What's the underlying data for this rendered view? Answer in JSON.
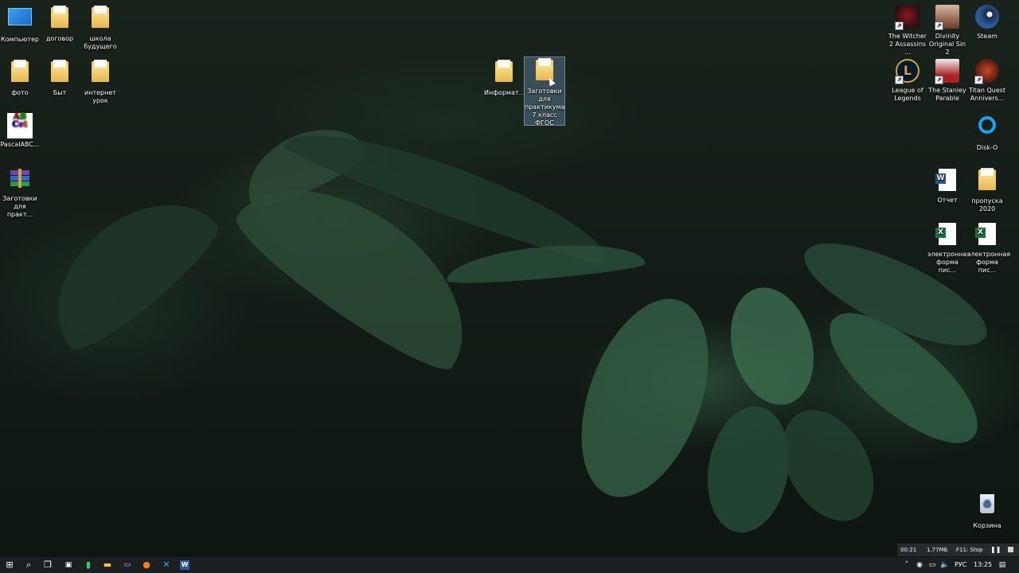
{
  "desktop": {
    "icons_left": [
      {
        "label": "Компьютер",
        "icon": "this-pc-icon"
      },
      {
        "label": "договор",
        "icon": "folder-icon"
      },
      {
        "label": "школа будущего",
        "icon": "folder-icon"
      },
      {
        "label": "фото",
        "icon": "folder-icon"
      },
      {
        "label": "Быт",
        "icon": "folder-icon"
      },
      {
        "label": "интернет урок",
        "icon": "folder-icon"
      },
      {
        "label": "PascalABC...",
        "icon": "pascalabc-icon"
      },
      {
        "label": "Заготовки для практ...",
        "icon": "winrar-archive-icon"
      }
    ],
    "icons_center": [
      {
        "label": "Информат...",
        "icon": "folder-icon"
      },
      {
        "label": "Заготовки для практикума 7 класс ФГОС",
        "icon": "folder-icon",
        "selected": true
      }
    ],
    "icons_right": [
      {
        "label": "The Witcher 2 Assassins ...",
        "icon": "witcher-game-icon"
      },
      {
        "label": "Divinity Original Sin 2",
        "icon": "divinity-game-icon"
      },
      {
        "label": "Steam",
        "icon": "steam-icon"
      },
      {
        "label": "League of Legends",
        "icon": "league-of-legends-icon"
      },
      {
        "label": "The Stanley Parable",
        "icon": "stanley-parable-icon"
      },
      {
        "label": "Titan Quest Annivers...",
        "icon": "titan-quest-icon"
      },
      {
        "label": "Disk-O",
        "icon": "disk-o-icon"
      },
      {
        "label": "Отчет",
        "icon": "word-document-icon"
      },
      {
        "label": "пропуска 2020",
        "icon": "folder-icon"
      },
      {
        "label": "электронная форма пис...",
        "icon": "excel-document-icon"
      },
      {
        "label": "электронная форма пис...",
        "icon": "excel-document-icon"
      },
      {
        "label": "Корзина",
        "icon": "recycle-bin-icon"
      }
    ]
  },
  "recorder": {
    "time": "00:21",
    "size": "1.77МБ",
    "stop_hint": "F11: Stop"
  },
  "taskbar": {
    "items": [
      "start-icon",
      "search-icon",
      "task-view-icon",
      "app-icon",
      "app-icon",
      "file-explorer-icon",
      "firefox-icon",
      "app-icon",
      "word-icon"
    ],
    "language": "РУС",
    "clock": "13:25"
  },
  "colors": {
    "taskbar": "#1c1f22",
    "selection": "#7aa0c8"
  }
}
